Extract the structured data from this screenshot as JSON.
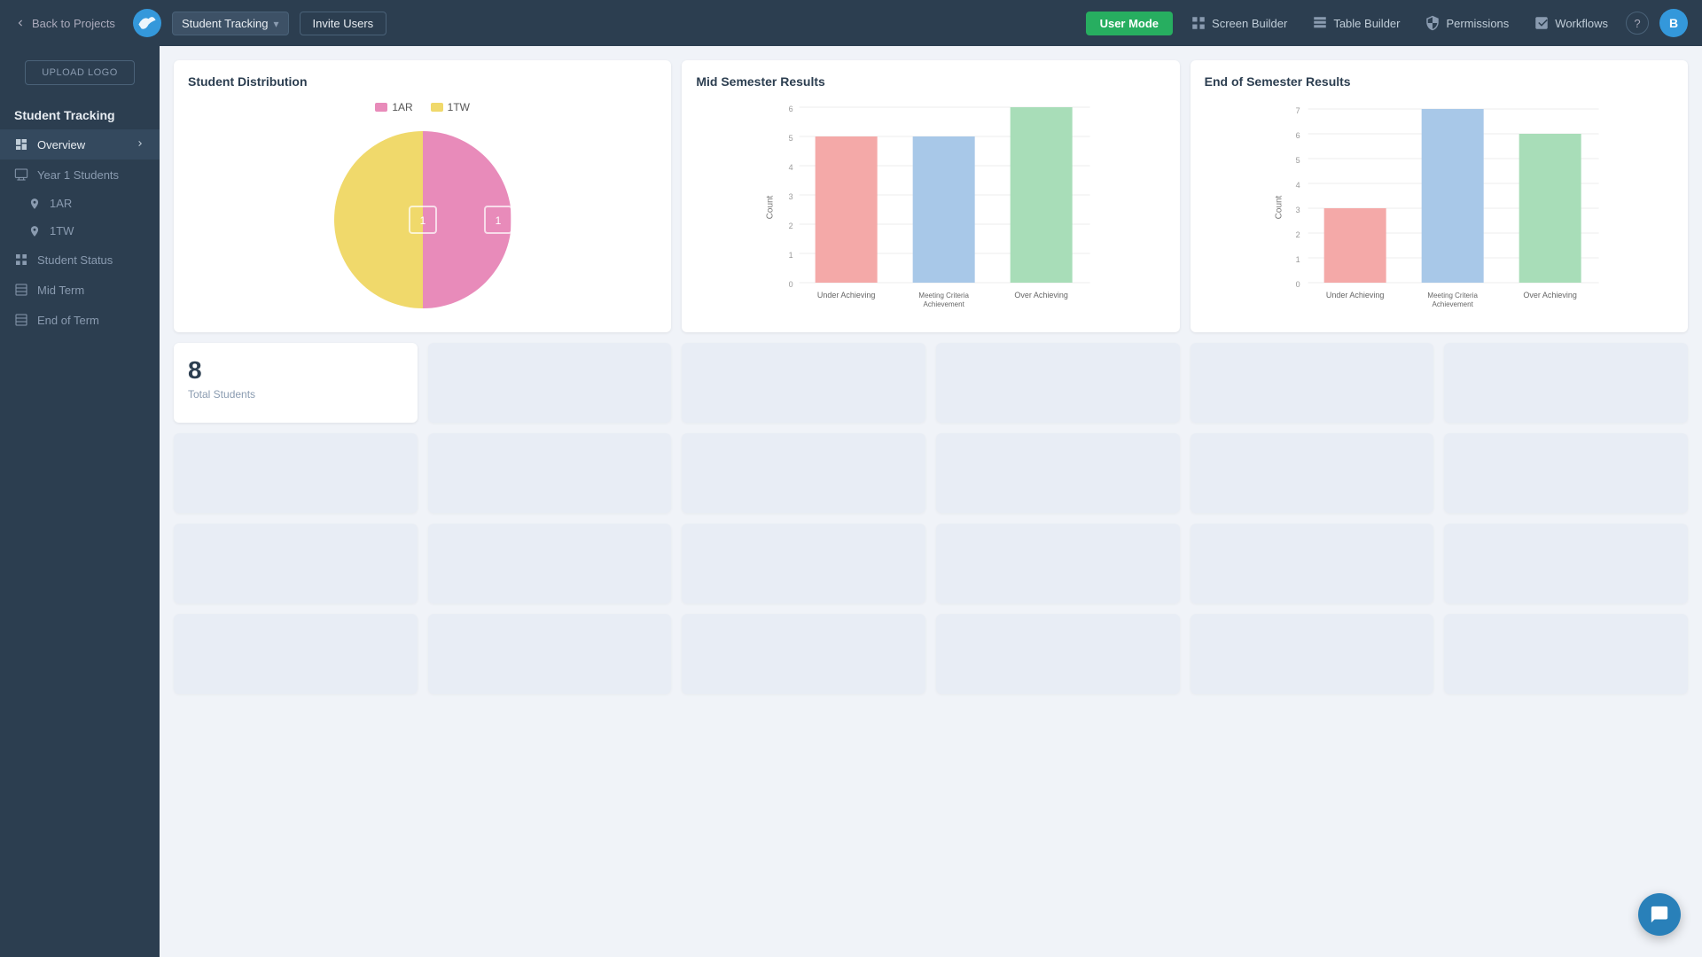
{
  "topNav": {
    "backLabel": "Back to Projects",
    "projectName": "Student Tracking",
    "inviteLabel": "Invite Users",
    "userModeLabel": "User Mode",
    "tools": [
      {
        "id": "screen-builder",
        "label": "Screen Builder"
      },
      {
        "id": "table-builder",
        "label": "Table Builder"
      },
      {
        "id": "permissions",
        "label": "Permissions"
      },
      {
        "id": "workflows",
        "label": "Workflows"
      }
    ],
    "avatarInitial": "B"
  },
  "sidebar": {
    "uploadLabel": "UPLOAD LOGO",
    "appTitle": "Student Tracking",
    "items": [
      {
        "id": "overview",
        "label": "Overview",
        "hasArrow": true,
        "active": true
      },
      {
        "id": "year1students",
        "label": "Year 1 Students"
      },
      {
        "id": "1ar",
        "label": "1AR",
        "sub": true
      },
      {
        "id": "1tw",
        "label": "1TW",
        "sub": true
      },
      {
        "id": "student-status",
        "label": "Student Status"
      },
      {
        "id": "mid-term",
        "label": "Mid Term"
      },
      {
        "id": "end-of-term",
        "label": "End of Term"
      }
    ]
  },
  "charts": {
    "distribution": {
      "title": "Student Distribution",
      "legend": [
        {
          "label": "1AR",
          "color": "#e88bba"
        },
        {
          "label": "1TW",
          "color": "#f0d96b"
        }
      ],
      "pieData": [
        {
          "label": "1AR",
          "value": 50,
          "color": "#e88bba"
        },
        {
          "label": "1TW",
          "value": 50,
          "color": "#f0d96b"
        }
      ]
    },
    "midSemester": {
      "title": "Mid Semester Results",
      "yMax": 6,
      "yTicks": [
        0,
        1,
        2,
        3,
        4,
        5,
        6
      ],
      "yLabel": "Count",
      "categories": [
        "Under Achieving",
        "Meeting Criteria Achievement",
        "Over Achieving"
      ],
      "bars": [
        {
          "label": "Under Achieving",
          "value": 5,
          "color": "#f4a9a8"
        },
        {
          "label": "Meeting Criteria Achievement",
          "value": 5,
          "color": "#a8c8e8"
        },
        {
          "label": "Over Achieving",
          "value": 6,
          "color": "#a8ddb8"
        }
      ]
    },
    "endSemester": {
      "title": "End of Semester Results",
      "yMax": 7,
      "yTicks": [
        0,
        1,
        2,
        3,
        4,
        5,
        6,
        7
      ],
      "yLabel": "Count",
      "categories": [
        "Under Achieving",
        "Meeting Criteria Achievement",
        "Over Achieving"
      ],
      "bars": [
        {
          "label": "Under Achieving",
          "value": 3,
          "color": "#f4a9a8"
        },
        {
          "label": "Meeting Criteria Achievement",
          "value": 7,
          "color": "#a8c8e8"
        },
        {
          "label": "Over Achieving",
          "value": 6,
          "color": "#a8ddb8"
        }
      ]
    }
  },
  "stats": {
    "totalStudents": "8",
    "totalLabel": "Total Students"
  },
  "chat": {
    "label": "Chat"
  }
}
